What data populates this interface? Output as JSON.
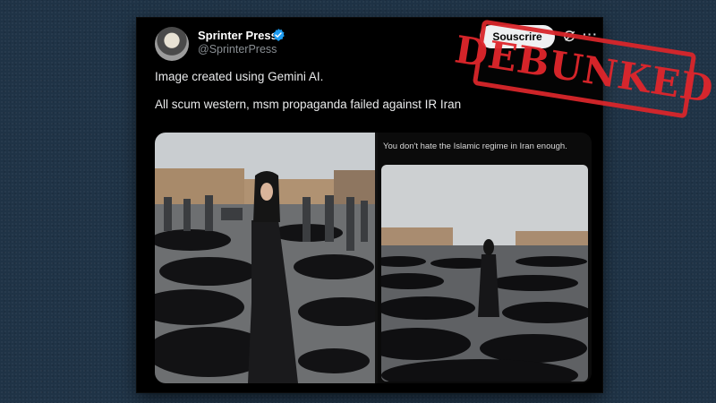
{
  "post": {
    "author_name": "Sprinter Press",
    "handle": "@SprinterPress",
    "follow_label": "Souscrire",
    "text_line1": "Image created using Gemini AI.",
    "text_line2": "All scum western, msm propaganda failed against IR Iran"
  },
  "media": {
    "right_caption": "You don't hate the Islamic regime in Iran enough."
  },
  "stamp": {
    "text": "DEBUNKED"
  },
  "colors": {
    "background": "#1f3346",
    "stamp_red": "#e0262c",
    "verified_blue": "#1d9bf0"
  }
}
